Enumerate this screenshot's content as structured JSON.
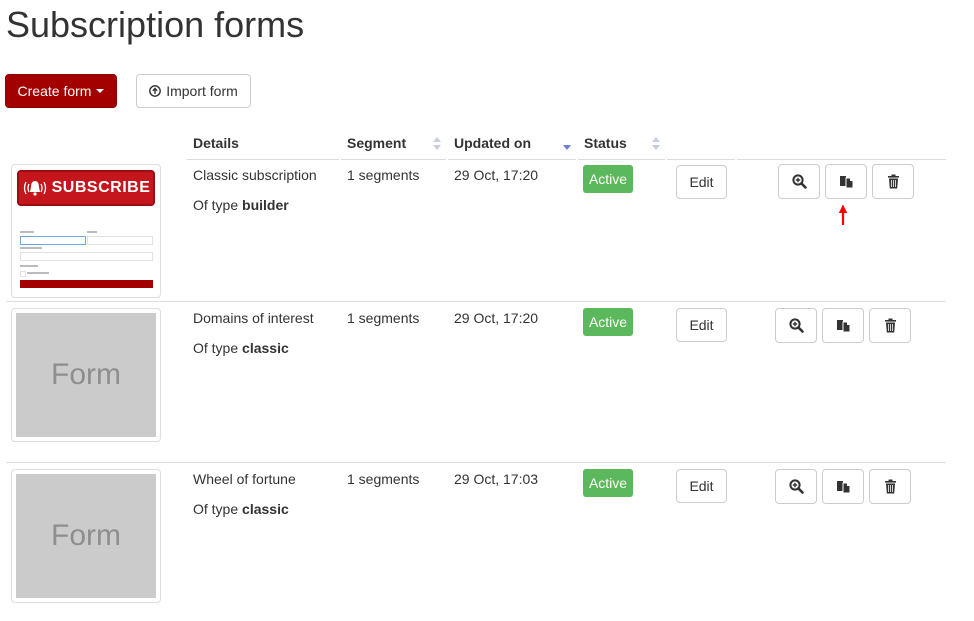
{
  "page": {
    "title": "Subscription forms"
  },
  "toolbar": {
    "create_label": "Create form",
    "import_label": "Import form"
  },
  "table": {
    "headers": {
      "details": "Details",
      "segment": "Segment",
      "updated": "Updated on",
      "status": "Status"
    },
    "type_prefix": "Of type",
    "rows": [
      {
        "name": "Classic subscription",
        "type": "builder",
        "segments": "1 segments",
        "updated": "29 Oct, 17:20",
        "status": "Active",
        "edit": "Edit",
        "thumb_text": "SUBSCRIBE"
      },
      {
        "name": "Domains of interest",
        "type": "classic",
        "segments": "1 segments",
        "updated": "29 Oct, 17:20",
        "status": "Active",
        "edit": "Edit",
        "thumb_text": "Form"
      },
      {
        "name": "Wheel of fortune",
        "type": "classic",
        "segments": "1 segments",
        "updated": "29 Oct, 17:03",
        "status": "Active",
        "edit": "Edit",
        "thumb_text": "Form"
      }
    ]
  },
  "colors": {
    "brand": "#a30000",
    "active": "#5cb85c",
    "annotation_arrow": "#ff0000"
  }
}
